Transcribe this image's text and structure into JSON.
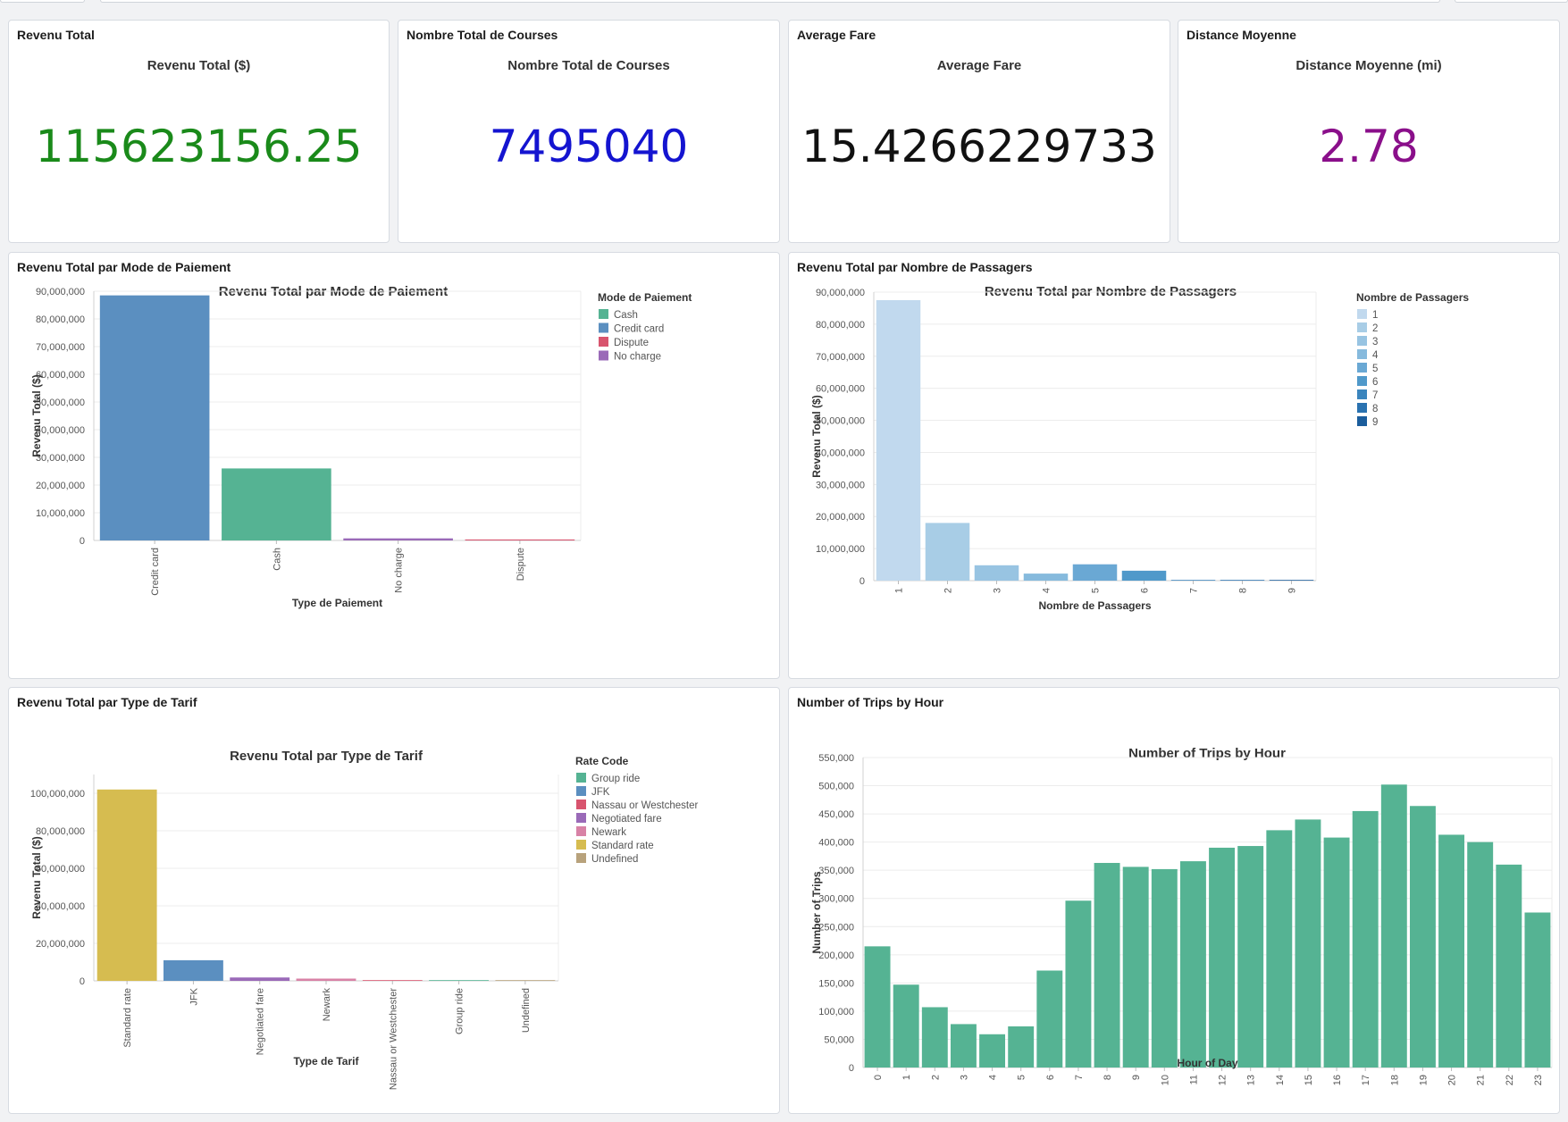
{
  "kpis": [
    {
      "panel_title": "Revenu Total",
      "subtitle": "Revenu Total ($)",
      "value": "115623156.25",
      "color": "#1a8a1a"
    },
    {
      "panel_title": "Nombre Total de Courses",
      "subtitle": "Nombre Total de Courses",
      "value": "7495040",
      "color": "#1414d0"
    },
    {
      "panel_title": "Average Fare",
      "subtitle": "Average Fare",
      "value": "15.4266229733",
      "color": "#111111"
    },
    {
      "panel_title": "Distance Moyenne",
      "subtitle": "Distance Moyenne (mi)",
      "value": "2.78",
      "color": "#8a0f8a"
    }
  ],
  "panels": {
    "payment": "Revenu Total par Mode de Paiement",
    "passengers": "Revenu Total par Nombre de Passagers",
    "ratecode": "Revenu Total par Type de Tarif",
    "hourly": "Number of Trips by Hour"
  },
  "chart_data": [
    {
      "id": "payment",
      "type": "bar",
      "title": "Revenu Total par Mode de Paiement",
      "xlabel": "Type de Paiement",
      "ylabel": "Revenu Total ($)",
      "ylim": [
        0,
        90000000
      ],
      "yticks": [
        0,
        10000000,
        20000000,
        30000000,
        40000000,
        50000000,
        60000000,
        70000000,
        80000000,
        90000000
      ],
      "categories": [
        "Credit card",
        "Cash",
        "No charge",
        "Dispute"
      ],
      "values": [
        88500000,
        26000000,
        750000,
        350000
      ],
      "colors": [
        "#5b8fc0",
        "#55b393",
        "#9a6ab8",
        "#d8546e"
      ],
      "legend": {
        "title": "Mode de Paiement",
        "position": "right",
        "items": [
          {
            "label": "Cash",
            "color": "#55b393"
          },
          {
            "label": "Credit card",
            "color": "#5b8fc0"
          },
          {
            "label": "Dispute",
            "color": "#d8546e"
          },
          {
            "label": "No charge",
            "color": "#9a6ab8"
          }
        ]
      },
      "grid": true
    },
    {
      "id": "passengers",
      "type": "bar",
      "title": "Revenu Total par Nombre de Passagers",
      "xlabel": "Nombre de Passagers",
      "ylabel": "Revenu Total ($)",
      "ylim": [
        0,
        90000000
      ],
      "yticks": [
        0,
        10000000,
        20000000,
        30000000,
        40000000,
        50000000,
        60000000,
        70000000,
        80000000,
        90000000
      ],
      "categories": [
        "1",
        "2",
        "3",
        "4",
        "5",
        "6",
        "7",
        "8",
        "9"
      ],
      "values": [
        87500000,
        18000000,
        4800000,
        2200000,
        5100000,
        3100000,
        5000,
        5000,
        5000
      ],
      "colors": [
        "#c1d9ee",
        "#a8cde6",
        "#98c4e2",
        "#86badd",
        "#6aa8d4",
        "#5099ca",
        "#3b85bd",
        "#2a72b0",
        "#1b5d9c"
      ],
      "legend": {
        "title": "Nombre de Passagers",
        "position": "right",
        "items": [
          {
            "label": "1",
            "color": "#c1d9ee"
          },
          {
            "label": "2",
            "color": "#a8cde6"
          },
          {
            "label": "3",
            "color": "#98c4e2"
          },
          {
            "label": "4",
            "color": "#86badd"
          },
          {
            "label": "5",
            "color": "#6aa8d4"
          },
          {
            "label": "6",
            "color": "#5099ca"
          },
          {
            "label": "7",
            "color": "#3b85bd"
          },
          {
            "label": "8",
            "color": "#2a72b0"
          },
          {
            "label": "9",
            "color": "#1b5d9c"
          }
        ]
      },
      "grid": true
    },
    {
      "id": "ratecode",
      "type": "bar",
      "title": "Revenu Total par Type de Tarif",
      "xlabel": "Type de Tarif",
      "ylabel": "Revenu Total ($)",
      "ylim": [
        0,
        110000000
      ],
      "yticks": [
        0,
        20000000,
        40000000,
        60000000,
        80000000,
        100000000
      ],
      "categories": [
        "Standard rate",
        "JFK",
        "Negotiated fare",
        "Newark",
        "Nassau or Westchester",
        "Group ride",
        "Undefined"
      ],
      "values": [
        102000000,
        11000000,
        1800000,
        1200000,
        150000,
        20000,
        10000
      ],
      "colors": [
        "#d6bc50",
        "#5b8fc0",
        "#9a6ab8",
        "#d882a6",
        "#d8546e",
        "#55b393",
        "#b8a27c"
      ],
      "legend": {
        "title": "Rate Code",
        "position": "right",
        "items": [
          {
            "label": "Group ride",
            "color": "#55b393"
          },
          {
            "label": "JFK",
            "color": "#5b8fc0"
          },
          {
            "label": "Nassau or Westchester",
            "color": "#d8546e"
          },
          {
            "label": "Negotiated fare",
            "color": "#9a6ab8"
          },
          {
            "label": "Newark",
            "color": "#d882a6"
          },
          {
            "label": "Standard rate",
            "color": "#d6bc50"
          },
          {
            "label": "Undefined",
            "color": "#b8a27c"
          }
        ]
      },
      "grid": true
    },
    {
      "id": "hourly",
      "type": "bar",
      "title": "Number of Trips by Hour",
      "xlabel": "Hour of Day",
      "ylabel": "Number of Trips",
      "ylim": [
        0,
        550000
      ],
      "yticks": [
        0,
        50000,
        100000,
        150000,
        200000,
        250000,
        300000,
        350000,
        400000,
        450000,
        500000,
        550000
      ],
      "categories": [
        "0",
        "1",
        "2",
        "3",
        "4",
        "5",
        "6",
        "7",
        "8",
        "9",
        "10",
        "11",
        "12",
        "13",
        "14",
        "15",
        "16",
        "17",
        "18",
        "19",
        "20",
        "21",
        "22",
        "23"
      ],
      "values": [
        215000,
        147000,
        107000,
        77000,
        59000,
        73000,
        172000,
        296000,
        363000,
        356000,
        352000,
        366000,
        390000,
        393000,
        421000,
        440000,
        408000,
        455000,
        502000,
        464000,
        413000,
        400000,
        360000,
        275000
      ],
      "colors": [
        "#55b393"
      ],
      "grid": true
    }
  ]
}
